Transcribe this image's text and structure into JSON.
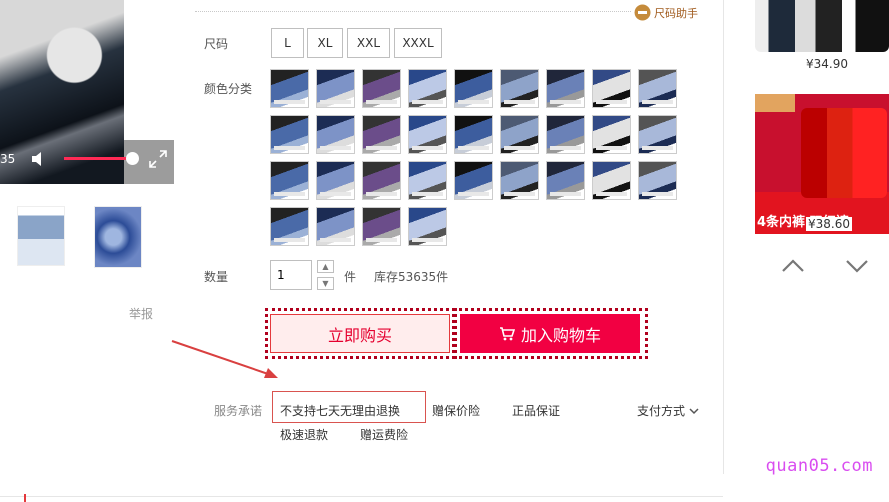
{
  "video": {
    "time": "35"
  },
  "report": "举报",
  "size_helper": "尺码助手",
  "size": {
    "label": "尺码",
    "options": [
      "L",
      "XL",
      "XXL",
      "XXXL"
    ]
  },
  "color": {
    "label": "颜色分类"
  },
  "quantity": {
    "label": "数量",
    "value": "1",
    "unit": "件",
    "stock": "库存53635件"
  },
  "buttons": {
    "buy_now": "立即购买",
    "add_cart": "加入购物车"
  },
  "service": {
    "label": "服务承诺",
    "items": [
      "不支持七天无理由退换",
      "赠保价险",
      "正品保证",
      "极速退款",
      "赠运费险"
    ],
    "payment": "支付方式"
  },
  "side": {
    "price1": "¥34.90",
    "price2": "¥38.60",
    "promo_text": "4条内裤 双红裤"
  },
  "watermark": "quan05.com",
  "colors": {
    "brand_red": "#f20042",
    "accent": "#e5002f",
    "annotation": "#d9534f"
  }
}
